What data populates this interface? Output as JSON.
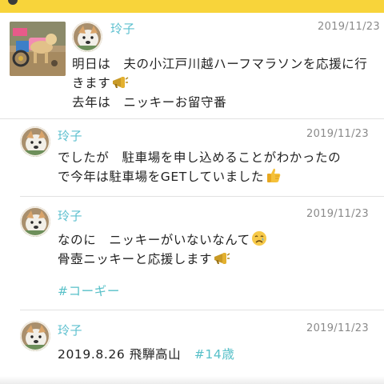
{
  "posts": [
    {
      "author": "玲子",
      "date": "2019/11/23",
      "lines": [
        "明日は　夫の小江戸川越ハーフマラソンを応援に行",
        "きます",
        "去年は　ニッキーお留守番"
      ],
      "emoji_line2": "megaphone"
    },
    {
      "author": "玲子",
      "date": "2019/11/23",
      "lines": [
        "でしたが　駐車場を申し込めることがわかったの",
        "で今年は駐車場をGETしていました"
      ],
      "emoji_line2": "thumbs-up"
    },
    {
      "author": "玲子",
      "date": "2019/11/23",
      "lines": [
        "なのに　ニッキーがいないなんて",
        "骨壺ニッキーと応援します"
      ],
      "emoji_line1": "crying-face",
      "emoji_line2": "megaphone",
      "tag": "#コーギー"
    },
    {
      "author": "玲子",
      "date": "2019/11/23",
      "text": "2019.8.26 飛騨高山",
      "tag": "#14歳"
    }
  ],
  "colors": {
    "accent_bar": "#f8d43a",
    "author": "#5dc0cf",
    "tag": "#57c0c8",
    "date": "#8a8a8a",
    "divider": "#e2e2e2"
  },
  "icons": [
    "megaphone",
    "thumbs-up",
    "crying-face",
    "dog-photo",
    "dog-avatar"
  ]
}
